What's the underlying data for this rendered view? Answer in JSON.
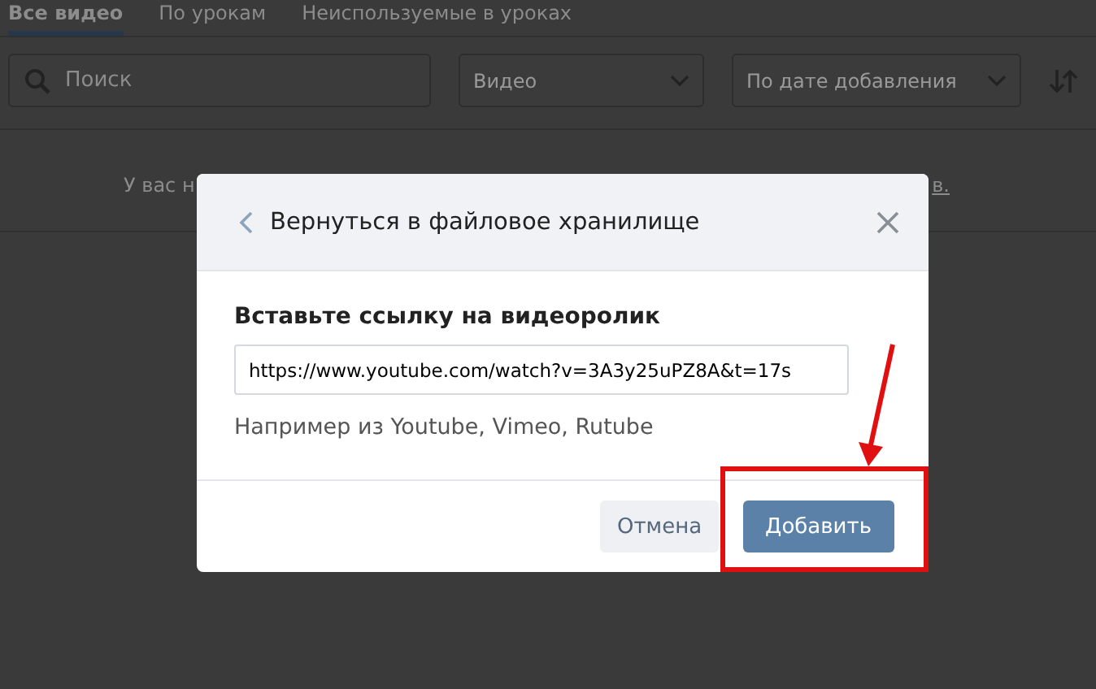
{
  "tabs": [
    {
      "label": "Все видео",
      "selected": true
    },
    {
      "label": "По урокам",
      "selected": false
    },
    {
      "label": "Неиспользуемые в уроках",
      "selected": false
    }
  ],
  "filters": {
    "search": {
      "placeholder": "Поиск"
    },
    "type_select": {
      "value": "Видео"
    },
    "sort_select": {
      "value": "По дате добавления"
    }
  },
  "empty_notice": {
    "start": "У вас н",
    "end": "в."
  },
  "dialog": {
    "back_link": "Вернуться в файловое хранилище",
    "label": "Вставьте ссылку на видеоролик",
    "url_field": {
      "value": "https://www.youtube.com/watch?v=3A3y25uPZ8A&t=17s"
    },
    "hint": "Например из Youtube, Vimeo, Rutube",
    "buttons": [
      {
        "label": "Отмена",
        "kind": "secondary"
      },
      {
        "label": "Добавить",
        "kind": "primary"
      }
    ]
  }
}
